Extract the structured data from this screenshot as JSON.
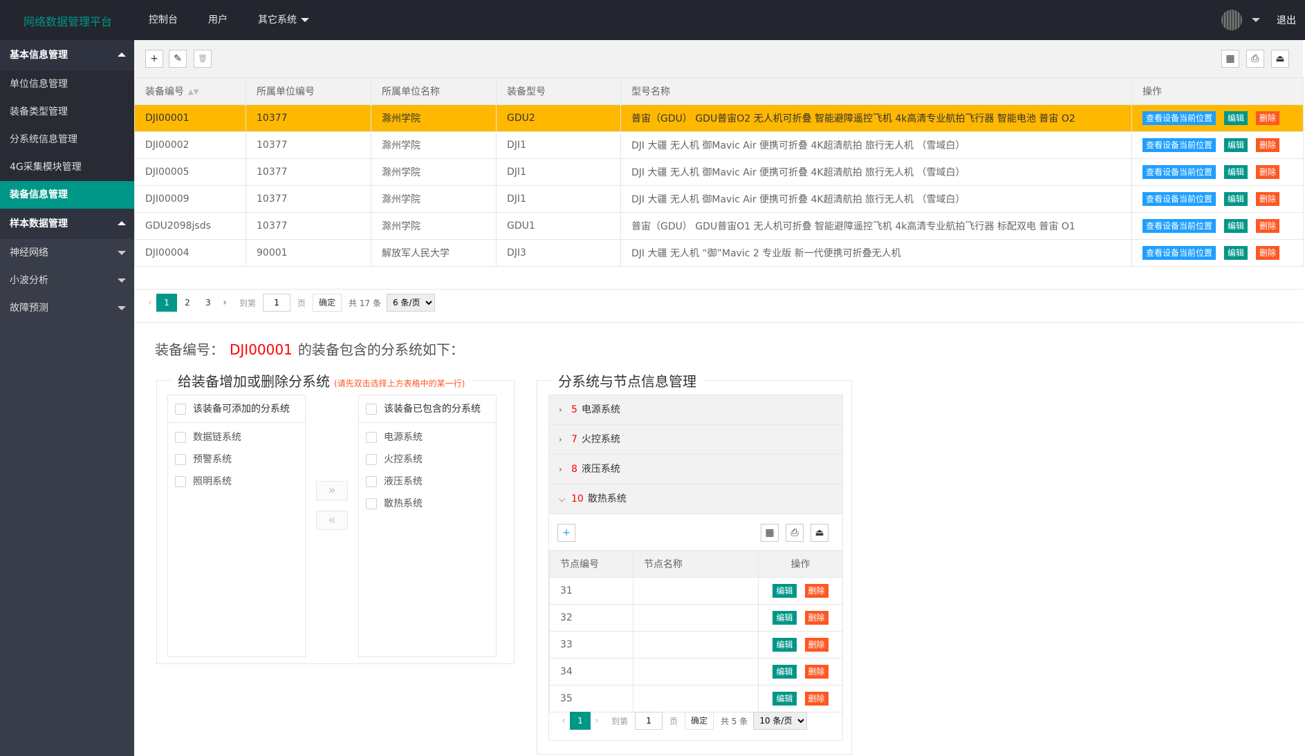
{
  "header": {
    "logo": "网络数据管理平台",
    "nav": [
      "控制台",
      "用户",
      "其它系统"
    ],
    "logout": "退出"
  },
  "sidebar": {
    "group1": "基本信息管理",
    "group1_items": [
      "单位信息管理",
      "装备类型管理",
      "分系统信息管理",
      "4G采集模块管理",
      "装备信息管理"
    ],
    "group2": "样本数据管理",
    "group2_items": [
      "神经网络",
      "小波分析",
      "故障预测"
    ]
  },
  "toolbar": {
    "add": "+",
    "edit": "✎",
    "delete": "🗑",
    "columns": "▦",
    "print": "⎙",
    "export": "⏏"
  },
  "table": {
    "columns": [
      "装备编号",
      "所属单位编号",
      "所属单位名称",
      "装备型号",
      "型号名称",
      "操作"
    ],
    "action_locate": "查看设备当前位置",
    "action_edit": "编辑",
    "action_delete": "删除",
    "rows": [
      {
        "id": "DJI00001",
        "unit_no": "10377",
        "unit_name": "滁州学院",
        "model": "GDU2",
        "model_name": "普宙（GDU） GDU普宙O2 无人机可折叠 智能避障遥控飞机 4k高清专业航拍飞行器 智能电池 普宙 O2",
        "selected": true
      },
      {
        "id": "DJI00002",
        "unit_no": "10377",
        "unit_name": "滁州学院",
        "model": "DJI1",
        "model_name": "DJI 大疆 无人机 御Mavic Air 便携可折叠 4K超清航拍 旅行无人机 （雪域白）",
        "selected": false
      },
      {
        "id": "DJI00005",
        "unit_no": "10377",
        "unit_name": "滁州学院",
        "model": "DJI1",
        "model_name": "DJI 大疆 无人机 御Mavic Air 便携可折叠 4K超清航拍 旅行无人机 （雪域白）",
        "selected": false
      },
      {
        "id": "DJI00009",
        "unit_no": "10377",
        "unit_name": "滁州学院",
        "model": "DJI1",
        "model_name": "DJI 大疆 无人机 御Mavic Air 便携可折叠 4K超清航拍 旅行无人机 （雪域白）",
        "selected": false
      },
      {
        "id": "GDU2098jsds",
        "unit_no": "10377",
        "unit_name": "滁州学院",
        "model": "GDU1",
        "model_name": "普宙（GDU） GDU普宙O1 无人机可折叠 智能避障遥控飞机 4k高清专业航拍飞行器 标配双电 普宙 O1",
        "selected": false
      },
      {
        "id": "DJI00004",
        "unit_no": "90001",
        "unit_name": "解放军人民大学",
        "model": "DJI3",
        "model_name": "DJI 大疆 无人机 “御”Mavic 2 专业版 新一代便携可折叠无人机",
        "selected": false
      }
    ]
  },
  "pager_main": {
    "pages": [
      "1",
      "2",
      "3"
    ],
    "goto_label": "到第",
    "goto_value": "1",
    "page_unit": "页",
    "confirm": "确定",
    "total": "共 17 条",
    "per_page": "6 条/页"
  },
  "detail": {
    "prefix": "装备编号：",
    "equip_id": "DJI00001",
    "suffix": "的装备包含的分系统如下："
  },
  "transfer": {
    "legend": "给装备增加或删除分系统",
    "hint": "(请先双击选择上方表格中的某一行)",
    "left_title": "该装备可添加的分系统",
    "left_items": [
      "数据链系统",
      "预警系统",
      "照明系统"
    ],
    "right_title": "该装备已包含的分系统",
    "right_items": [
      "电源系统",
      "火控系统",
      "液压系统",
      "散热系统"
    ],
    "to_right": "»",
    "to_left": "«"
  },
  "subsystems": {
    "legend": "分系统与节点信息管理",
    "items": [
      {
        "num": "5",
        "name": "电源系统",
        "expanded": false
      },
      {
        "num": "7",
        "name": "火控系统",
        "expanded": false
      },
      {
        "num": "8",
        "name": "液压系统",
        "expanded": false
      },
      {
        "num": "10",
        "name": "散热系统",
        "expanded": true
      }
    ],
    "node_columns": [
      "节点编号",
      "节点名称",
      "操作"
    ],
    "nodes": [
      "31",
      "32",
      "33",
      "34",
      "35"
    ],
    "edit": "编辑",
    "delete": "删除"
  },
  "pager_nodes": {
    "page": "1",
    "goto_label": "到第",
    "goto_value": "1",
    "page_unit": "页",
    "confirm": "确定",
    "total": "共 5 条",
    "per_page": "10 条/页"
  },
  "colors": {
    "header_bg": "#23262e",
    "sidebar_bg": "#393d49",
    "accent": "#009688",
    "selected_row": "#ffb800",
    "blue_btn": "#1e9fff",
    "red_btn": "#ff5722",
    "highlight_text": "#ff0000"
  }
}
